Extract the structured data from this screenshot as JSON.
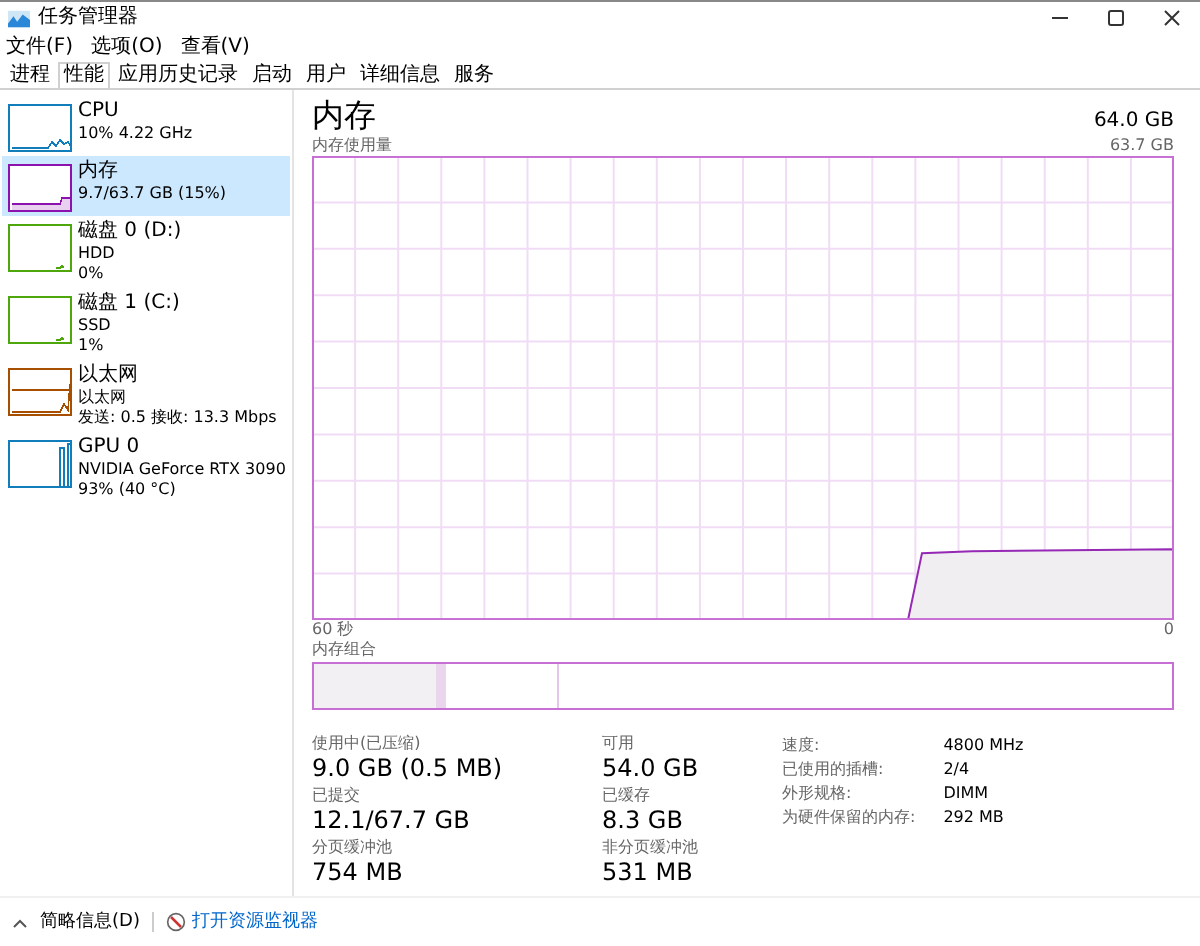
{
  "window": {
    "title": "任务管理器"
  },
  "menu": [
    "文件(F)",
    "选项(O)",
    "查看(V)"
  ],
  "tabs": [
    {
      "label": "进程",
      "selected": false
    },
    {
      "label": "性能",
      "selected": true
    },
    {
      "label": "应用历史记录",
      "selected": false
    },
    {
      "label": "启动",
      "selected": false
    },
    {
      "label": "用户",
      "selected": false
    },
    {
      "label": "详细信息",
      "selected": false
    },
    {
      "label": "服务",
      "selected": false
    }
  ],
  "sidebar": {
    "items": [
      {
        "kind": "cpu",
        "name": "CPU",
        "lines": [
          "10% 4.22 GHz"
        ],
        "color": "#117dbb",
        "selected": false
      },
      {
        "kind": "memory",
        "name": "内存",
        "lines": [
          "9.7/63.7 GB (15%)"
        ],
        "color": "#8b12ae",
        "selected": true
      },
      {
        "kind": "disk",
        "name": "磁盘 0 (D:)",
        "lines": [
          "HDD",
          "0%"
        ],
        "color": "#4da60c",
        "selected": false
      },
      {
        "kind": "disk",
        "name": "磁盘 1 (C:)",
        "lines": [
          "SSD",
          "1%"
        ],
        "color": "#4da60c",
        "selected": false
      },
      {
        "kind": "ethernet",
        "name": "以太网",
        "lines": [
          "以太网",
          "发送: 0.5 接收: 13.3 Mbps"
        ],
        "color": "#a74f01",
        "selected": false
      },
      {
        "kind": "gpu",
        "name": "GPU 0",
        "lines": [
          "NVIDIA GeForce RTX 3090",
          "93% (40 °C)"
        ],
        "color": "#117dbb",
        "selected": false
      }
    ]
  },
  "main": {
    "title": "内存",
    "total": "64.0 GB",
    "usage_label": "内存使用量",
    "usage_max": "63.7 GB",
    "time_start": "60 秒",
    "time_end": "0",
    "composition_label": "内存组合",
    "stats": [
      {
        "label": "使用中(已压缩)",
        "value": "9.0 GB (0.5 MB)"
      },
      {
        "label": "可用",
        "value": "54.0 GB"
      },
      {
        "label": "已提交",
        "value": "12.1/67.7 GB"
      },
      {
        "label": "已缓存",
        "value": "8.3 GB"
      },
      {
        "label": "分页缓冲池",
        "value": "754 MB"
      },
      {
        "label": "非分页缓冲池",
        "value": "531 MB"
      }
    ],
    "details": [
      {
        "label": "速度:",
        "value": "4800 MHz"
      },
      {
        "label": "已使用的插槽:",
        "value": "2/4"
      },
      {
        "label": "外形规格:",
        "value": "DIMM"
      },
      {
        "label": "为硬件保留的内存:",
        "value": "292 MB"
      }
    ]
  },
  "footer": {
    "fewer_details": "简略信息(D)",
    "open_monitor": "打开资源监视器"
  }
}
